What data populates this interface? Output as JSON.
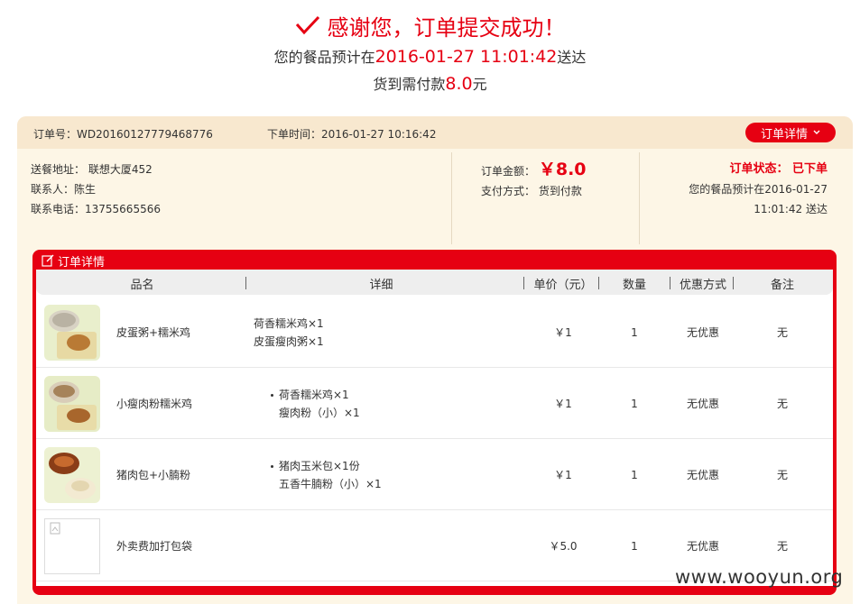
{
  "success": {
    "title": "感谢您，订单提交成功！",
    "line1_prefix": "您的餐品预计在",
    "line1_time": "2016-01-27 11:01:42",
    "line1_suffix": "送达",
    "line2_prefix": "货到需付款",
    "line2_amount": "8.0",
    "line2_suffix": "元"
  },
  "order": {
    "number": "订单号：WD20160127779468776",
    "time": "下单时间：2016-01-27 10:16:42",
    "detail_button": "订单详情",
    "address": "送餐地址： 联想大厦452",
    "contact": "联系人：陈生",
    "phone": "联系电话：13755665566",
    "amount_label": "订单金额：",
    "amount_value": "￥8.0",
    "payment": "支付方式： 货到付款",
    "status_label": "订单状态： 已下单",
    "eta": "您的餐品预计在2016-01-27 11:01:42 送达"
  },
  "panel": {
    "title": "订单详情",
    "headers": [
      "品名",
      "详细",
      "单价（元）",
      "数量",
      "优惠方式",
      "备注"
    ]
  },
  "items": [
    {
      "name": "皮蛋粥+糯米鸡",
      "details": [
        "荷香糯米鸡×1",
        "皮蛋瘦肉粥×1"
      ],
      "bullets": false,
      "price": "￥1",
      "qty": "1",
      "discount": "无优惠",
      "note": "无"
    },
    {
      "name": "小瘦肉粉糯米鸡",
      "details": [
        "荷香糯米鸡×1",
        "瘦肉粉（小）×1"
      ],
      "bullets": true,
      "price": "￥1",
      "qty": "1",
      "discount": "无优惠",
      "note": "无"
    },
    {
      "name": "猪肉包+小腩粉",
      "details": [
        "猪肉玉米包×1份",
        "五香牛腩粉（小）×1"
      ],
      "bullets": true,
      "price": "￥1",
      "qty": "1",
      "discount": "无优惠",
      "note": "无"
    },
    {
      "name": "外卖费加打包袋",
      "details": [],
      "bullets": false,
      "price": "￥5.0",
      "qty": "1",
      "discount": "无优惠",
      "note": "无"
    }
  ],
  "watermark": "www.wooyun.org",
  "colors": {
    "accent": "#e60012",
    "card_bg": "#fdf6e6",
    "card_top": "#f8e8cf"
  }
}
